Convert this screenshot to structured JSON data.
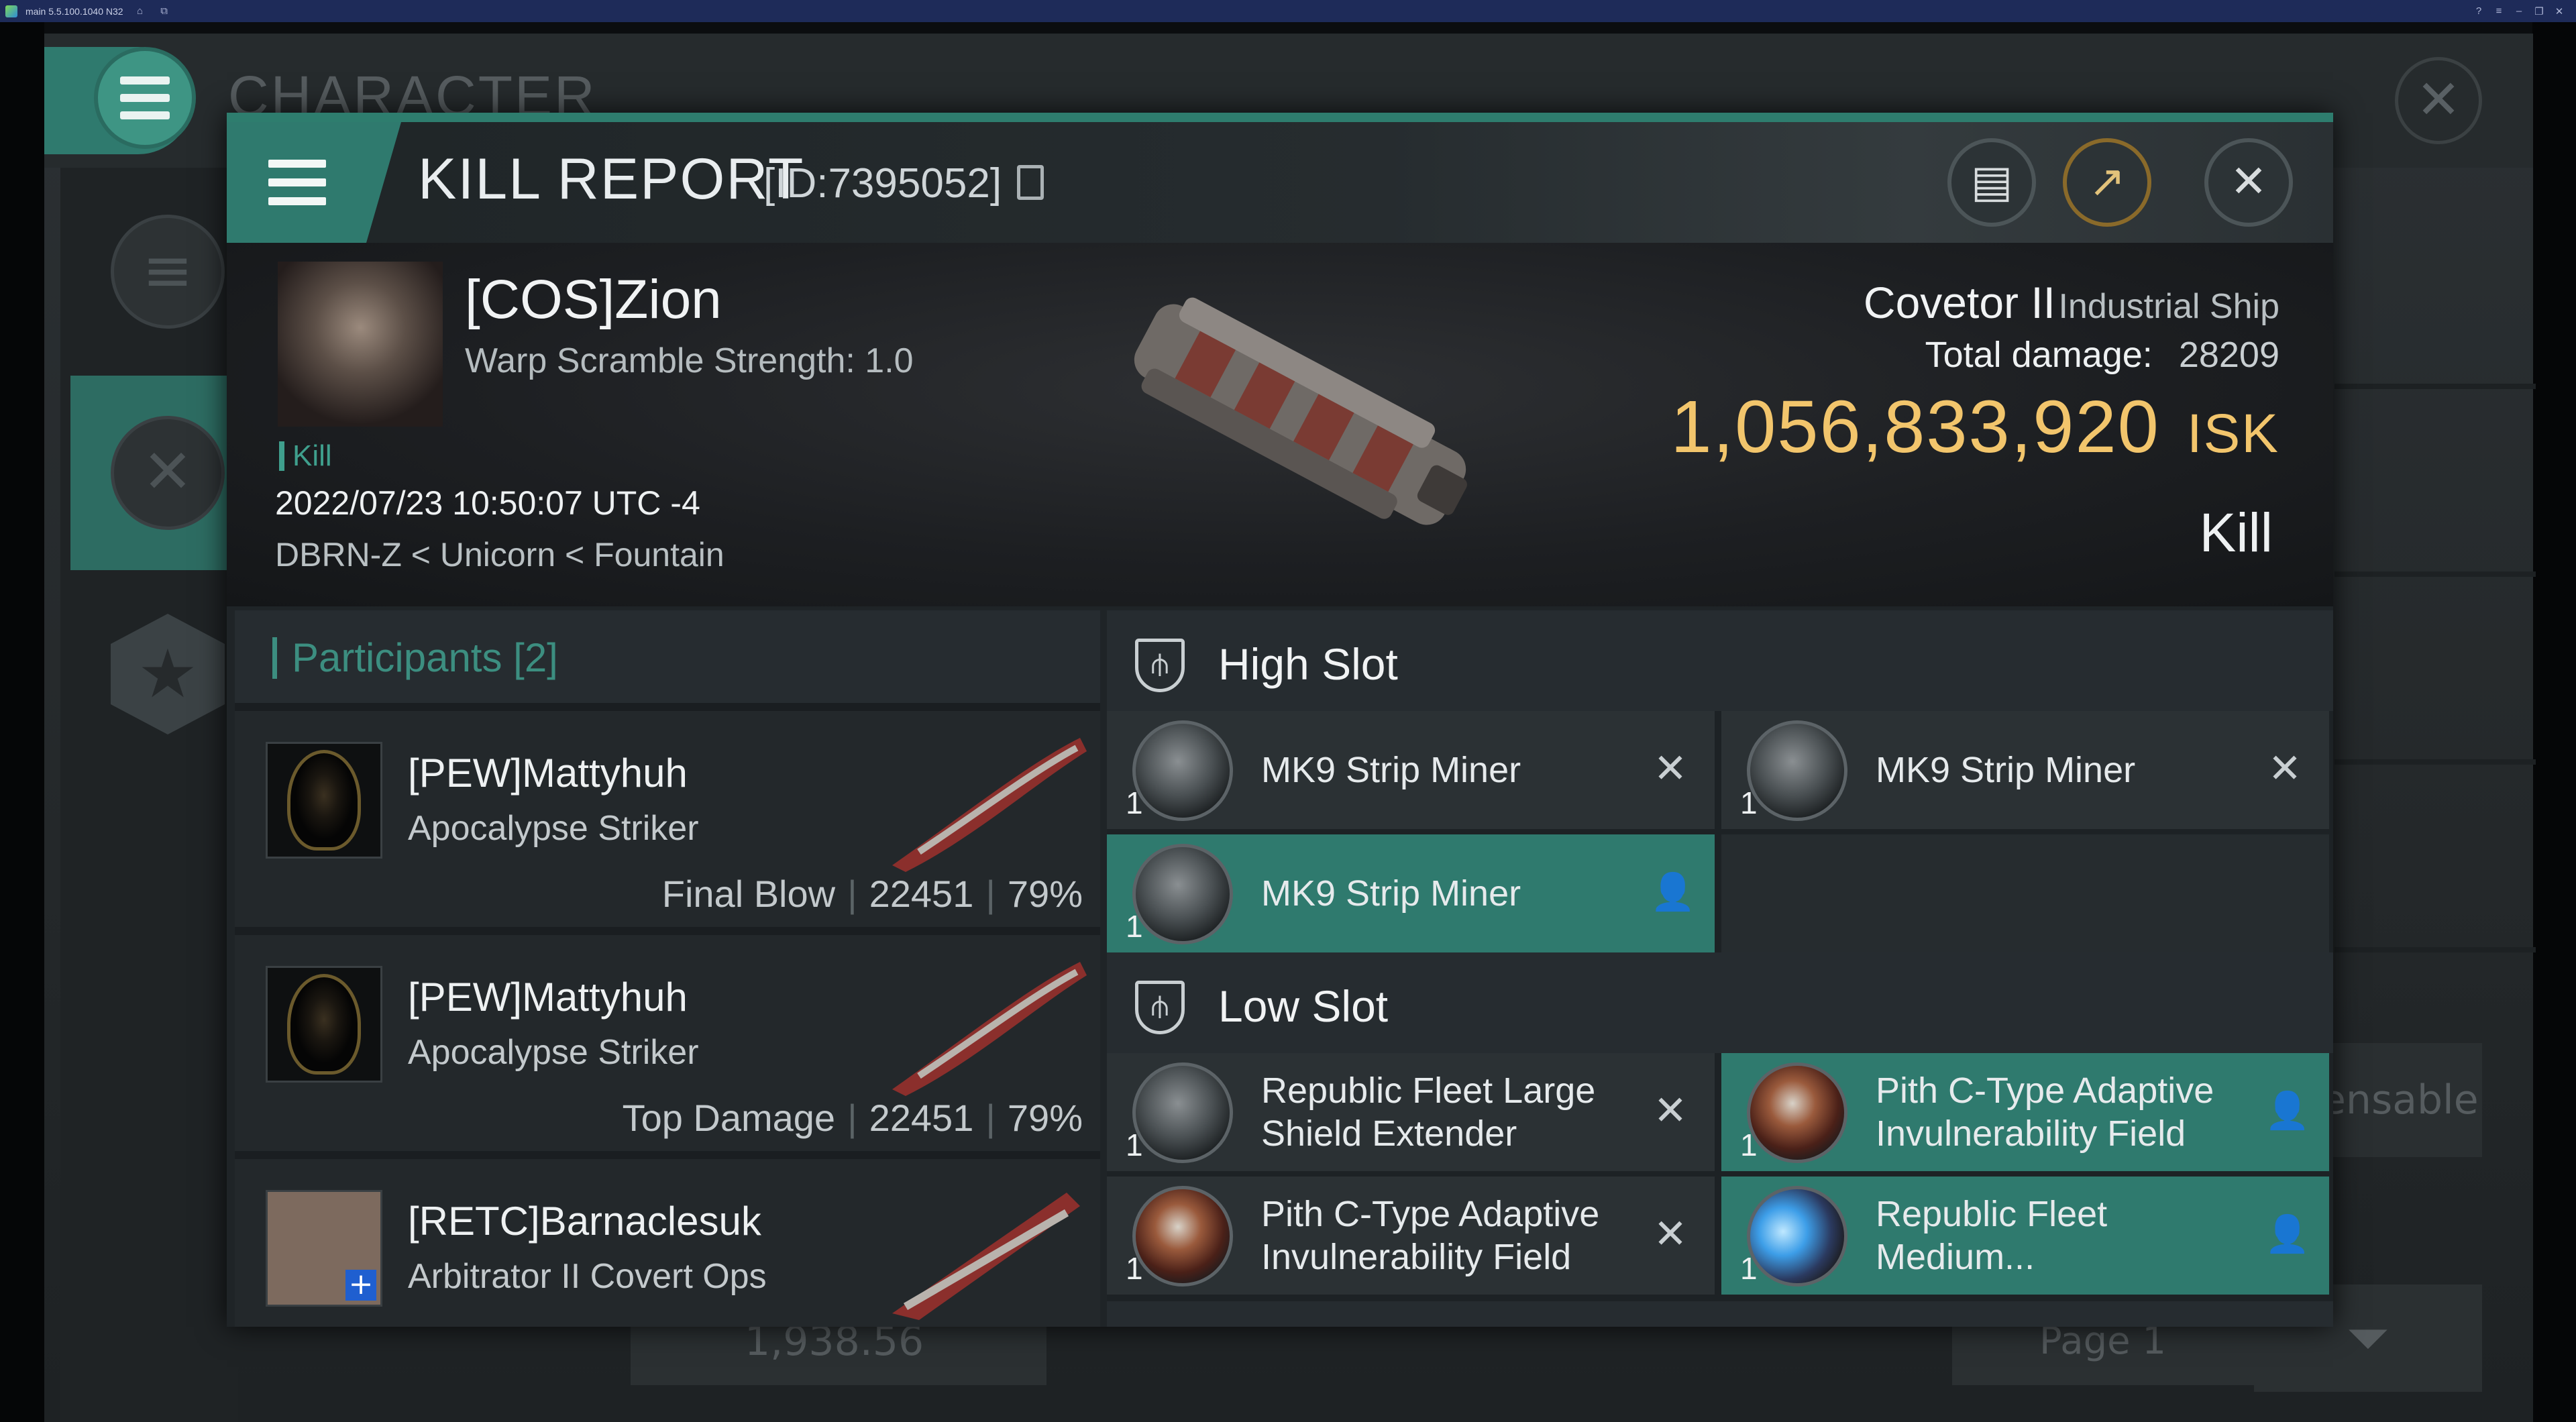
{
  "window": {
    "title": "main 5.5.100.1040 N32"
  },
  "background": {
    "title": "CHARACTER",
    "right_button": "ensable",
    "bottom_value": "1,938.56",
    "page_label": "Page 1"
  },
  "dialog": {
    "title": "KILL REPORT",
    "report_id": "[ID:7395052]"
  },
  "victim": {
    "name": "[COS]Zion",
    "warp_scramble": "Warp Scramble Strength: 1.0",
    "tag": "Kill",
    "datetime": "2022/07/23 10:50:07 UTC -4",
    "location": "DBRN-Z < Unicorn < Fountain",
    "ship_name": "Covetor II",
    "ship_class": "Industrial Ship",
    "total_damage_label": "Total damage:",
    "total_damage": "28209",
    "isk_value": "1,056,833,920",
    "isk_unit": "ISK",
    "result": "Kill"
  },
  "participants": {
    "title": "Participants [2]",
    "rows": [
      {
        "name": "[PEW]Mattyhuh",
        "ship": "Apocalypse Striker",
        "role": "Final Blow",
        "damage": "22451",
        "percent": "79%"
      },
      {
        "name": "[PEW]Mattyhuh",
        "ship": "Apocalypse Striker",
        "role": "Top Damage",
        "damage": "22451",
        "percent": "79%"
      },
      {
        "name": "[RETC]Barnaclesuk",
        "ship": "Arbitrator II Covert Ops",
        "role": "",
        "damage": "",
        "percent": ""
      }
    ]
  },
  "slots": {
    "high": {
      "label": "High Slot",
      "modules": [
        {
          "name": "MK9 Strip Miner",
          "qty": "1",
          "state": "destroyed",
          "state_icon": "✕"
        },
        {
          "name": "MK9 Strip Miner",
          "qty": "1",
          "state": "destroyed",
          "state_icon": "✕"
        },
        {
          "name": "MK9 Strip Miner",
          "qty": "1",
          "state": "dropped",
          "state_icon": "👤"
        }
      ]
    },
    "low": {
      "label": "Low Slot",
      "modules": [
        {
          "name": "Republic Fleet Large Shield Extender",
          "qty": "1",
          "state": "destroyed",
          "state_icon": "✕"
        },
        {
          "name": "Pith C-Type Adaptive Invulnerability Field",
          "qty": "1",
          "state": "dropped",
          "state_icon": "👤"
        },
        {
          "name": "Pith C-Type Adaptive Invulnerability Field",
          "qty": "1",
          "state": "destroyed",
          "state_icon": "✕"
        },
        {
          "name": "Republic Fleet Medium...",
          "qty": "1",
          "state": "dropped",
          "state_icon": "👤"
        }
      ]
    }
  },
  "colors": {
    "accent": "#2f7a6e",
    "isk": "#f2c56c",
    "panel": "#1f2427"
  }
}
